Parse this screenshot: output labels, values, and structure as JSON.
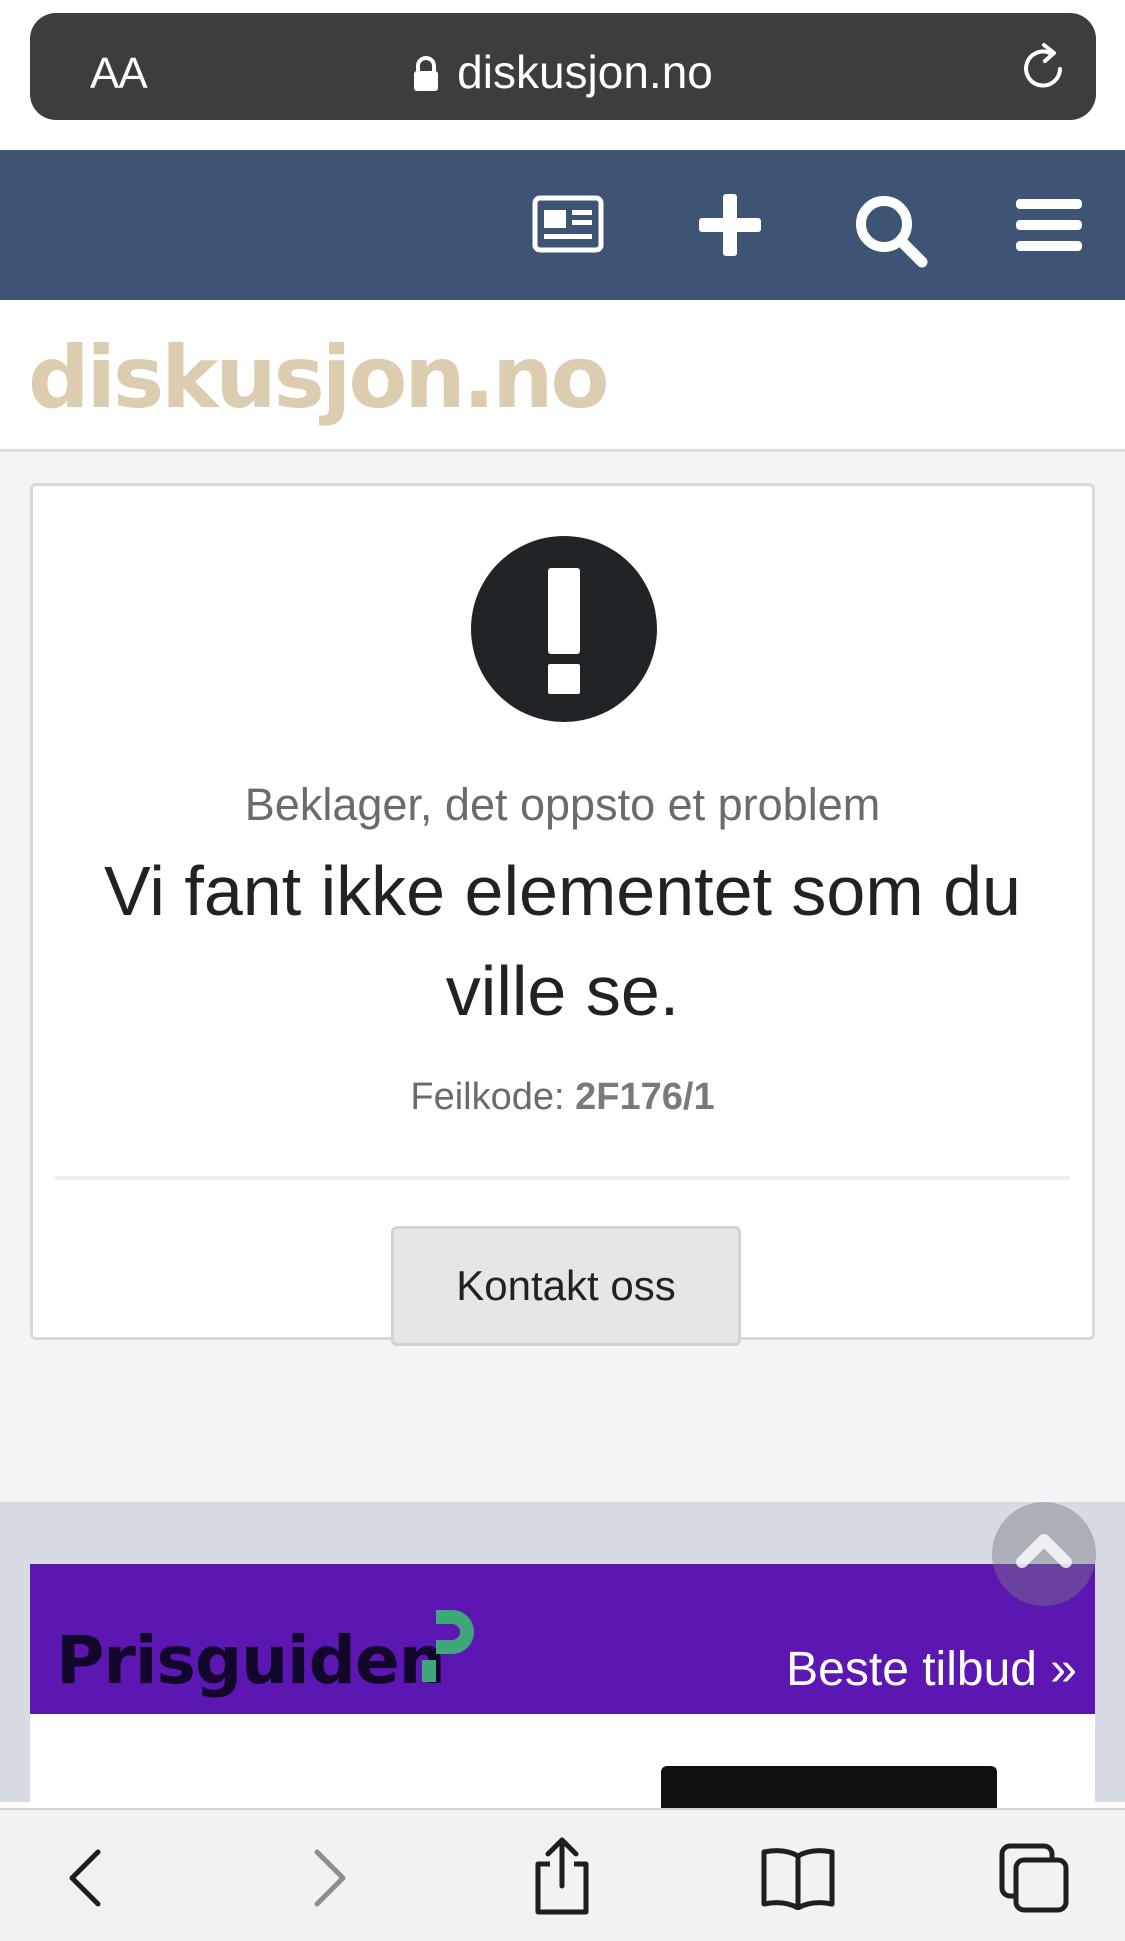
{
  "browser": {
    "text_size_label": "AA",
    "url": "diskusjon.no",
    "toolbar": {
      "back": "back-chevron-icon",
      "forward": "forward-chevron-icon",
      "share": "share-icon",
      "bookmarks": "book-icon",
      "tabs": "tabs-icon"
    }
  },
  "site_nav": {
    "background": "#3e5475",
    "icons": [
      "newspaper-icon",
      "plus-icon",
      "search-icon",
      "menu-icon"
    ]
  },
  "site": {
    "logo_text": "diskusjon.no",
    "logo_color": "#dccdb1"
  },
  "error": {
    "subtitle": "Beklager, det oppsto et problem",
    "message": "Vi fant ikke elementet som du ville se.",
    "code_label": "Feilkode:",
    "code_value": "2F176/1",
    "contact_button": "Kontakt oss"
  },
  "ad": {
    "brand": "Prisguiden",
    "cta": "Beste tilbud »",
    "background": "#5c16b1",
    "accent": "#3ea87a"
  }
}
